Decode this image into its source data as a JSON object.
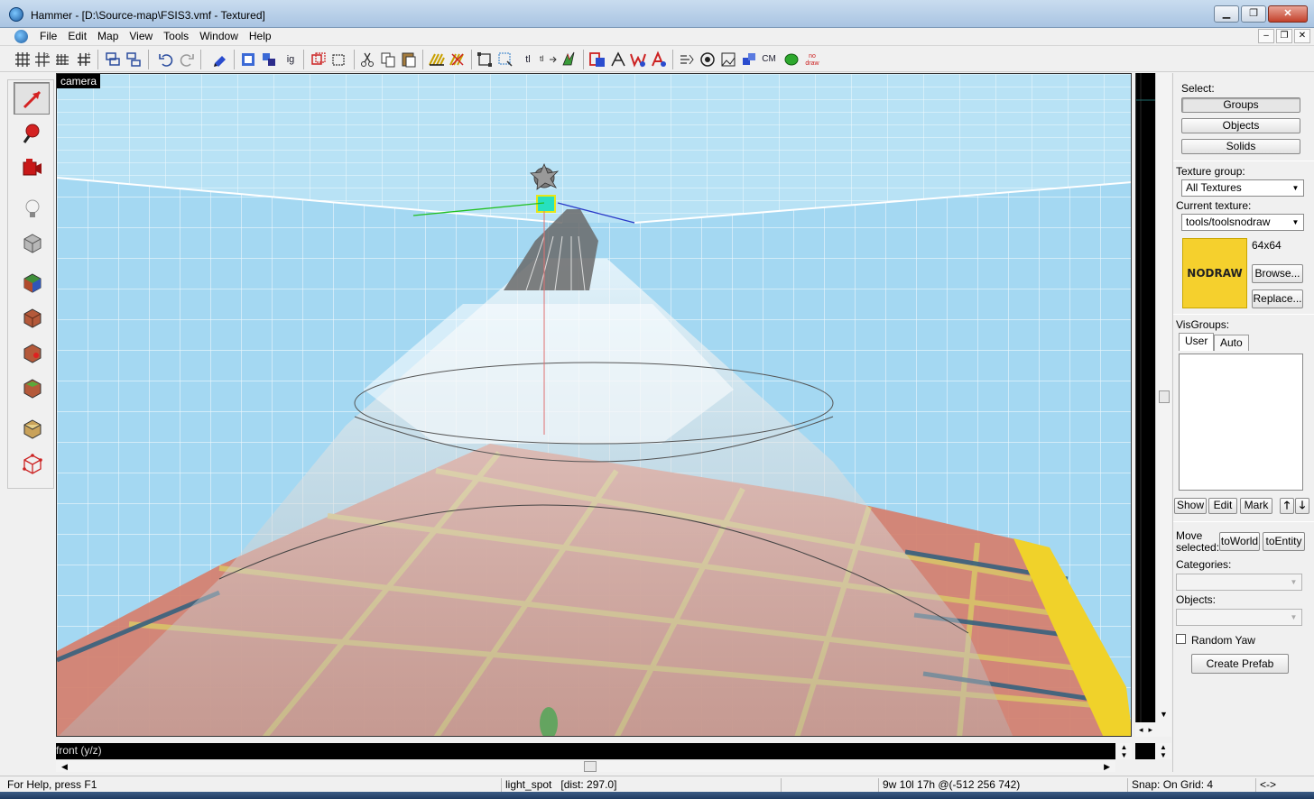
{
  "window": {
    "title": "Hammer - [D:\\Source-map\\FSIS3.vmf - Textured]",
    "minimize": "▁",
    "restore": "❐",
    "close": "✕"
  },
  "menu": {
    "items": [
      "File",
      "Edit",
      "Map",
      "View",
      "Tools",
      "Window",
      "Help"
    ],
    "mdi": [
      "–",
      "❐",
      "✕"
    ]
  },
  "toolbar": {
    "text_buttons": {
      "ig": "ig",
      "tl": "tl",
      "cm": "CM",
      "nodraw": "no draw"
    }
  },
  "left_tools": [
    {
      "name": "selection-tool",
      "icon": "arrow-icon"
    },
    {
      "name": "magnify-tool",
      "icon": "magnifier-icon"
    },
    {
      "name": "camera-tool",
      "icon": "camera-icon"
    },
    {
      "name": "entity-tool",
      "icon": "lightbulb-icon"
    },
    {
      "name": "block-tool",
      "icon": "cube-icon"
    },
    {
      "name": "texture-application-tool",
      "icon": "texture-cube-icon"
    },
    {
      "name": "apply-current-texture-tool",
      "icon": "brick-cube-icon"
    },
    {
      "name": "decal-tool",
      "icon": "decal-cube-icon"
    },
    {
      "name": "overlay-tool",
      "icon": "overlay-cube-icon"
    },
    {
      "name": "clipping-tool",
      "icon": "clip-cube-icon"
    },
    {
      "name": "vertex-tool",
      "icon": "vertex-cube-icon"
    }
  ],
  "viewports": {
    "camera_label": "camera",
    "front_label": "front (y/z)"
  },
  "right_panel": {
    "select_label": "Select:",
    "select_buttons": [
      "Groups",
      "Objects",
      "Solids"
    ],
    "texture_group_label": "Texture group:",
    "texture_group_value": "All Textures",
    "current_texture_label": "Current texture:",
    "current_texture_value": "tools/toolsnodraw",
    "texture_size": "64x64",
    "texture_preview_text": "NODRAW",
    "browse": "Browse...",
    "replace": "Replace...",
    "visgroups_label": "VisGroups:",
    "tabs": [
      "User",
      "Auto"
    ],
    "visgroup_buttons": [
      "Show",
      "Edit",
      "Mark"
    ],
    "move_selected_label": "Move selected:",
    "to_world": "toWorld",
    "to_entity": "toEntity",
    "categories_label": "Categories:",
    "objects_label": "Objects:",
    "random_yaw": "Random Yaw",
    "create_prefab": "Create Prefab"
  },
  "status": {
    "help": "For Help, press F1",
    "selection": "light_spot   [dist: 297.0]",
    "coords": "9w 10l 17h @(-512 256 742)",
    "snap": "Snap: On Grid: 4",
    "arrows": "<->"
  },
  "colors": {
    "sky": "#9fd5f0",
    "floor_red": "#d17b6a",
    "floor_trim": "#e8c43e",
    "nodraw_yellow": "#f5d02d"
  }
}
